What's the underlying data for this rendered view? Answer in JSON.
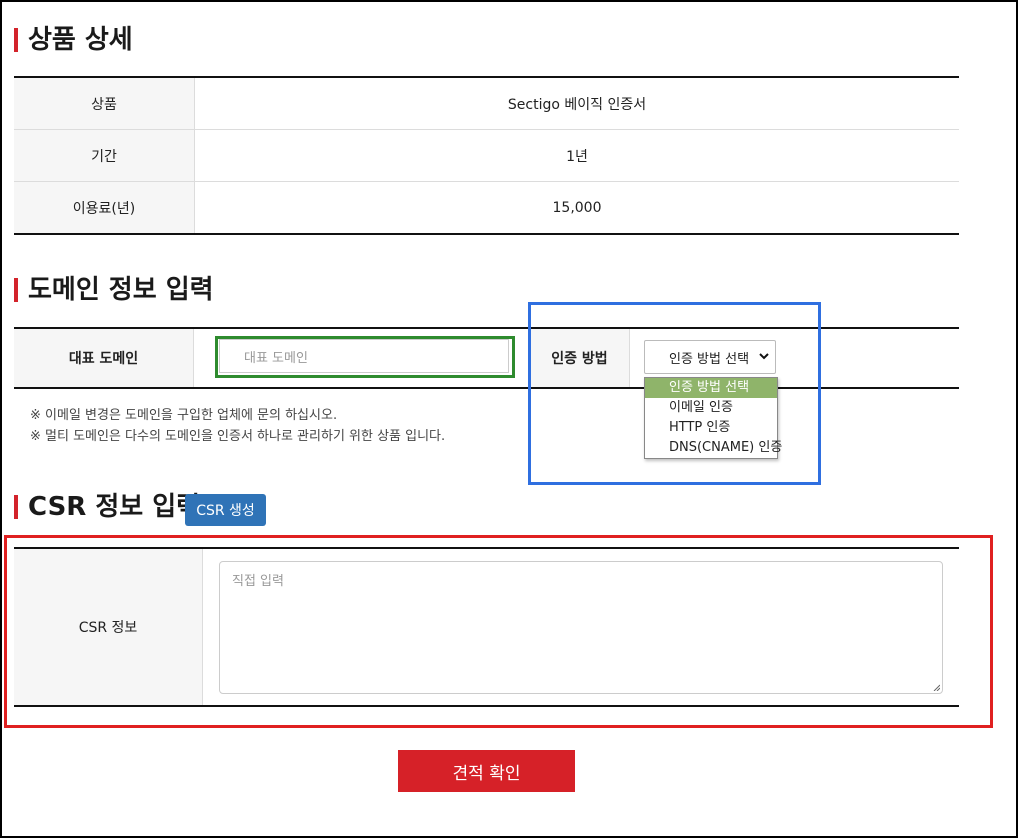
{
  "product_section": {
    "title": "상품 상세",
    "rows": [
      {
        "label": "상품",
        "value": "Sectigo 베이직 인증서"
      },
      {
        "label": "기간",
        "value": "1년"
      },
      {
        "label": "이용료(년)",
        "value": "15,000"
      }
    ]
  },
  "domain_section": {
    "title": "도메인 정보 입력",
    "domain_label": "대표 도메인",
    "domain_placeholder": "대표 도메인",
    "auth_label": "인증 방법",
    "auth_select_value": "인증 방법 선택",
    "auth_options": [
      "인증 방법 선택",
      "이메일 인증",
      "HTTP 인증",
      "DNS(CNAME) 인증"
    ],
    "notes": [
      "※ 이메일 변경은 도메인을 구입한 업체에 문의 하십시오.",
      "※ 멀티 도메인은 다수의 도메인을 인증서 하나로 관리하기 위한 상품 입니다."
    ]
  },
  "csr_section": {
    "title": "CSR 정보 입력",
    "generate_button": "CSR 생성",
    "label": "CSR 정보",
    "textarea_placeholder": "직접 입력"
  },
  "submit_button": "견적 확인",
  "colors": {
    "accent_red": "#d62128",
    "button_blue": "#2f73b7",
    "highlight_green": "#8fb46a"
  }
}
